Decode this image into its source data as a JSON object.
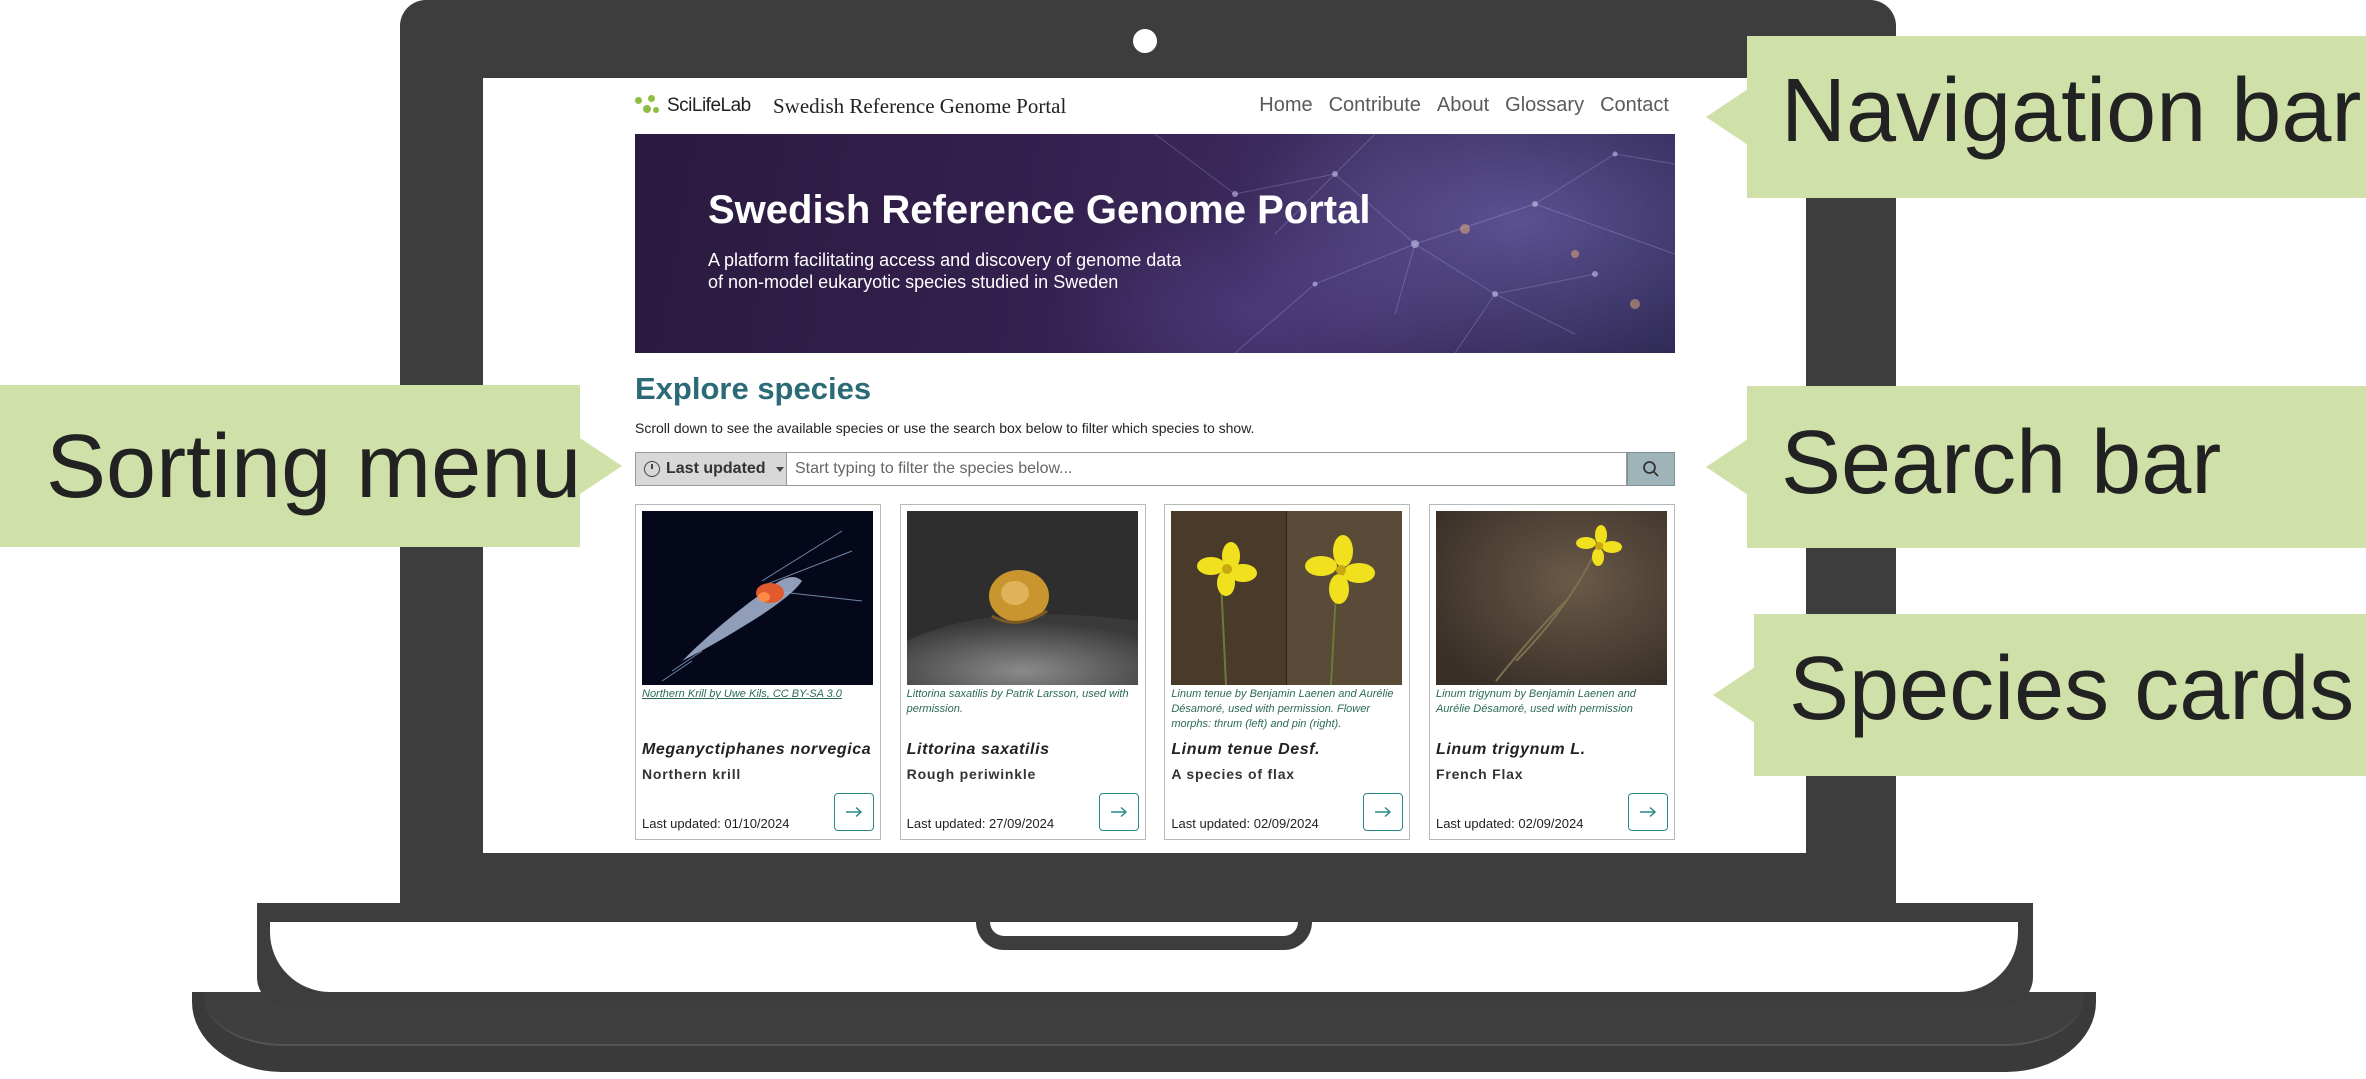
{
  "site": {
    "brand": "SciLifeLab",
    "title": "Swedish Reference Genome Portal"
  },
  "nav": {
    "items": [
      {
        "label": "Home"
      },
      {
        "label": "Contribute"
      },
      {
        "label": "About"
      },
      {
        "label": "Glossary"
      },
      {
        "label": "Contact"
      }
    ]
  },
  "hero": {
    "title": "Swedish Reference Genome Portal",
    "subtitle": "A platform facilitating access and discovery of genome data of non-model eukaryotic species studied in Sweden"
  },
  "explore": {
    "title": "Explore species",
    "description": "Scroll down to see the available species or use the search box below to filter which species to show.",
    "sort_label": "Last updated",
    "search_placeholder": "Start typing to filter the species below..."
  },
  "cards": [
    {
      "credit": "Northern Krill by Uwe Kils, CC BY-SA 3.0",
      "scientific_name": "Meganyctiphanes norvegica",
      "common_name": "Northern krill",
      "updated": "Last updated: 01/10/2024"
    },
    {
      "credit": "Littorina saxatilis by Patrik Larsson, used with permission.",
      "scientific_name": "Littorina saxatilis",
      "common_name": "Rough periwinkle",
      "updated": "Last updated: 27/09/2024"
    },
    {
      "credit": "Linum tenue by Benjamin Laenen and Aurélie Désamoré, used with permission. Flower morphs: thrum (left) and pin (right).",
      "scientific_name": "Linum tenue Desf.",
      "common_name": "A species of flax",
      "updated": "Last updated: 02/09/2024"
    },
    {
      "credit": "Linum trigynum by Benjamin Laenen and Aurélie Désamoré, used with permission",
      "scientific_name": "Linum trigynum L.",
      "common_name": "French Flax",
      "updated": "Last updated: 02/09/2024"
    }
  ],
  "callouts": {
    "navigation": "Navigation bar",
    "sorting": "Sorting menu",
    "search": "Search bar",
    "cards": "Species cards"
  },
  "colors": {
    "laptop": "#3d3d3d",
    "callout": "#cfe0a8",
    "accent_teal": "#2b6b78",
    "logo_green": "#8fbd44"
  }
}
